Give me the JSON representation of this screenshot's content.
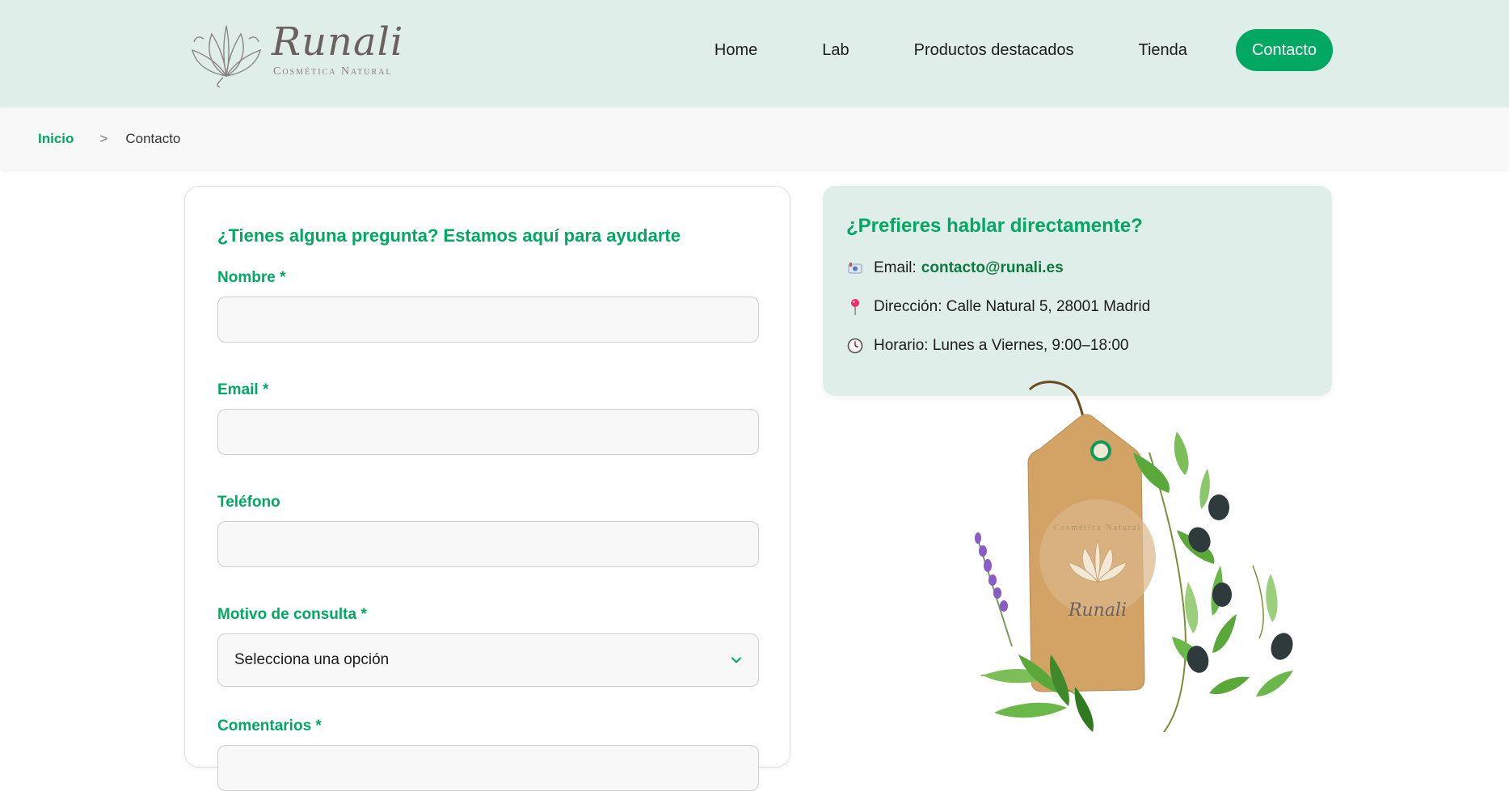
{
  "brand": {
    "name": "Runali",
    "tagline": "Cosmética Natural"
  },
  "nav": {
    "items": [
      "Home",
      "Lab",
      "Productos destacados",
      "Tienda"
    ],
    "cta": "Contacto"
  },
  "breadcrumb": {
    "home": "Inicio",
    "separator": ">",
    "current": "Contacto"
  },
  "form": {
    "title": "¿Tienes alguna pregunta? Estamos aquí para ayudarte",
    "name_label": "Nombre *",
    "email_label": "Email *",
    "phone_label": "Teléfono",
    "reason_label": "Motivo de consulta *",
    "reason_value": "Selecciona una opción",
    "comments_label": "Comentarios *"
  },
  "contact": {
    "title": "¿Prefieres hablar directamente?",
    "email_prefix": "Email:",
    "email": "contacto@runali.es",
    "address": "Dirección: Calle Natural 5, 28001 Madrid",
    "hours": "Horario: Lunes a Viernes, 9:00–18:00"
  },
  "tag": {
    "text": "Runali",
    "subtext": "Cosmética Natural"
  },
  "colors": {
    "accent": "#00a862",
    "header_bg": "#e0eeea",
    "info_bg": "#e0eeea"
  }
}
